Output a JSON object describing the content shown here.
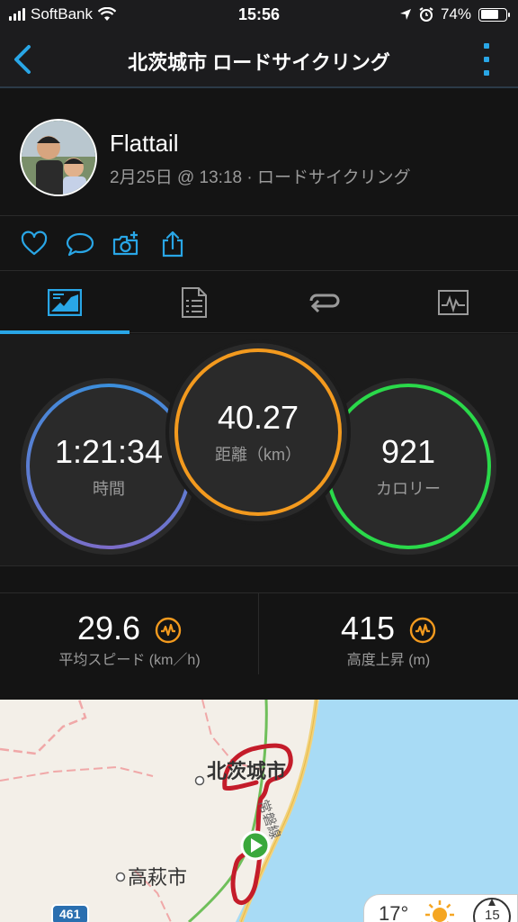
{
  "status_bar": {
    "carrier": "SoftBank",
    "time": "15:56",
    "battery_percent": "74%",
    "battery_level": 0.74
  },
  "nav": {
    "title": "北茨城市 ロードサイクリング",
    "back_icon": "chevron-left-icon",
    "more_icon": "kebab-menu-icon",
    "accent": "#29a6e6"
  },
  "profile": {
    "name": "Flattail",
    "meta": "2月25日 @ 13:18 · ロードサイクリング"
  },
  "actions": [
    {
      "name": "like-button",
      "icon": "heart-icon"
    },
    {
      "name": "comment-button",
      "icon": "speech-bubble-icon"
    },
    {
      "name": "add-photo-button",
      "icon": "camera-plus-icon"
    },
    {
      "name": "share-button",
      "icon": "share-icon"
    }
  ],
  "tabs": [
    {
      "name": "tab-overview",
      "icon": "overview-icon",
      "active": true
    },
    {
      "name": "tab-stats",
      "icon": "document-list-icon",
      "active": false
    },
    {
      "name": "tab-laps",
      "icon": "laps-icon",
      "active": false
    },
    {
      "name": "tab-charts",
      "icon": "chart-icon",
      "active": false
    }
  ],
  "circles": {
    "time": {
      "value": "1:21:34",
      "label": "時間"
    },
    "distance": {
      "value": "40.27",
      "label": "距離（km）"
    },
    "calories": {
      "value": "921",
      "label": "カロリー"
    }
  },
  "metrics": {
    "avg_speed": {
      "value": "29.6",
      "label": "平均スピード (km／h)"
    },
    "elevation_gain": {
      "value": "415",
      "label": "高度上昇 (m)"
    }
  },
  "map": {
    "labels": {
      "city1": "北茨城市",
      "city2": "高萩市",
      "rail": "常磐線",
      "route_no": "461"
    },
    "weather": {
      "temperature": "17°",
      "wind": "15"
    }
  }
}
